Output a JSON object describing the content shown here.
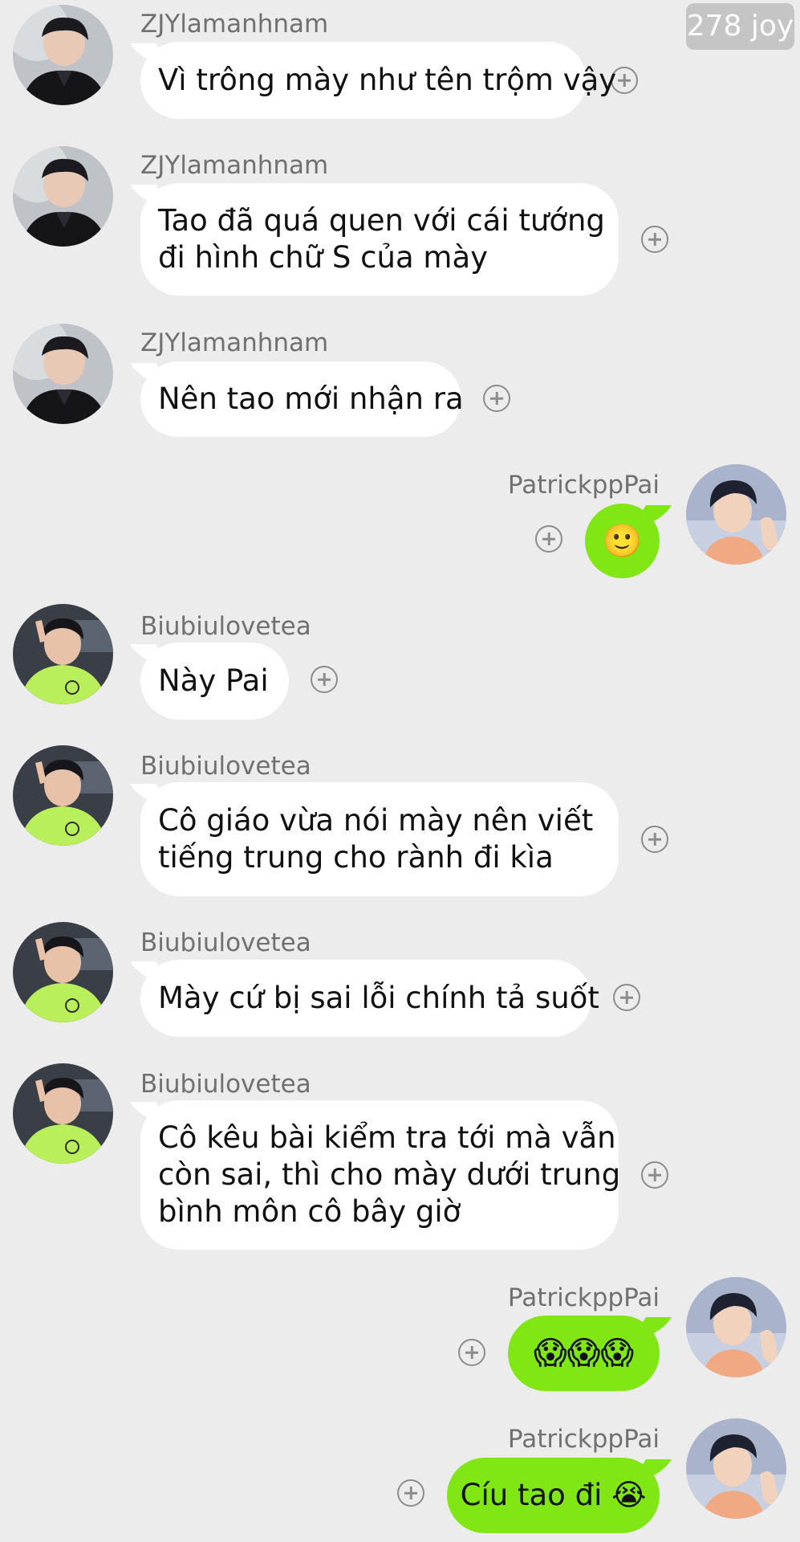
{
  "badge": {
    "text": "278 joy"
  },
  "messages": [
    {
      "sender": "ZJYlamanhnam",
      "side": "left",
      "avatar": "zjy-avatar",
      "text": "Vì trông mày như tên trộm vậy"
    },
    {
      "sender": "ZJYlamanhnam",
      "side": "left",
      "avatar": "zjy-avatar",
      "lines": [
        "Tao đã quá quen với cái tướng",
        "đi hình chữ S của mày"
      ]
    },
    {
      "sender": "ZJYlamanhnam",
      "side": "left",
      "avatar": "zjy-avatar",
      "text": "Nên tao mới nhận ra"
    },
    {
      "sender": "PatrickppPai",
      "side": "right",
      "avatar": "patrick-avatar",
      "text": "🙂"
    },
    {
      "sender": "Biubiulovetea",
      "side": "left",
      "avatar": "biubiu-avatar",
      "text": "Này Pai"
    },
    {
      "sender": "Biubiulovetea",
      "side": "left",
      "avatar": "biubiu-avatar",
      "lines": [
        "Cô giáo vừa nói mày nên viết",
        "tiếng trung cho rành đi kìa"
      ]
    },
    {
      "sender": "Biubiulovetea",
      "side": "left",
      "avatar": "biubiu-avatar",
      "text": "Mày cứ bị sai lỗi chính tả suốt"
    },
    {
      "sender": "Biubiulovetea",
      "side": "left",
      "avatar": "biubiu-avatar",
      "lines": [
        "Cô kêu bài kiểm tra tới mà vẫn",
        "còn sai, thì cho mày dưới trung",
        "bình môn cô bây giờ"
      ]
    },
    {
      "sender": "PatrickppPai",
      "side": "right",
      "avatar": "patrick-avatar",
      "text": "😱😱😱"
    },
    {
      "sender": "PatrickppPai",
      "side": "right",
      "avatar": "patrick-avatar",
      "text": "Cíu tao đi 😭"
    }
  ],
  "colors": {
    "background": "#ececec",
    "incoming_bubble": "#ffffff",
    "outgoing_bubble": "#80e614",
    "sender_text": "#707070"
  }
}
